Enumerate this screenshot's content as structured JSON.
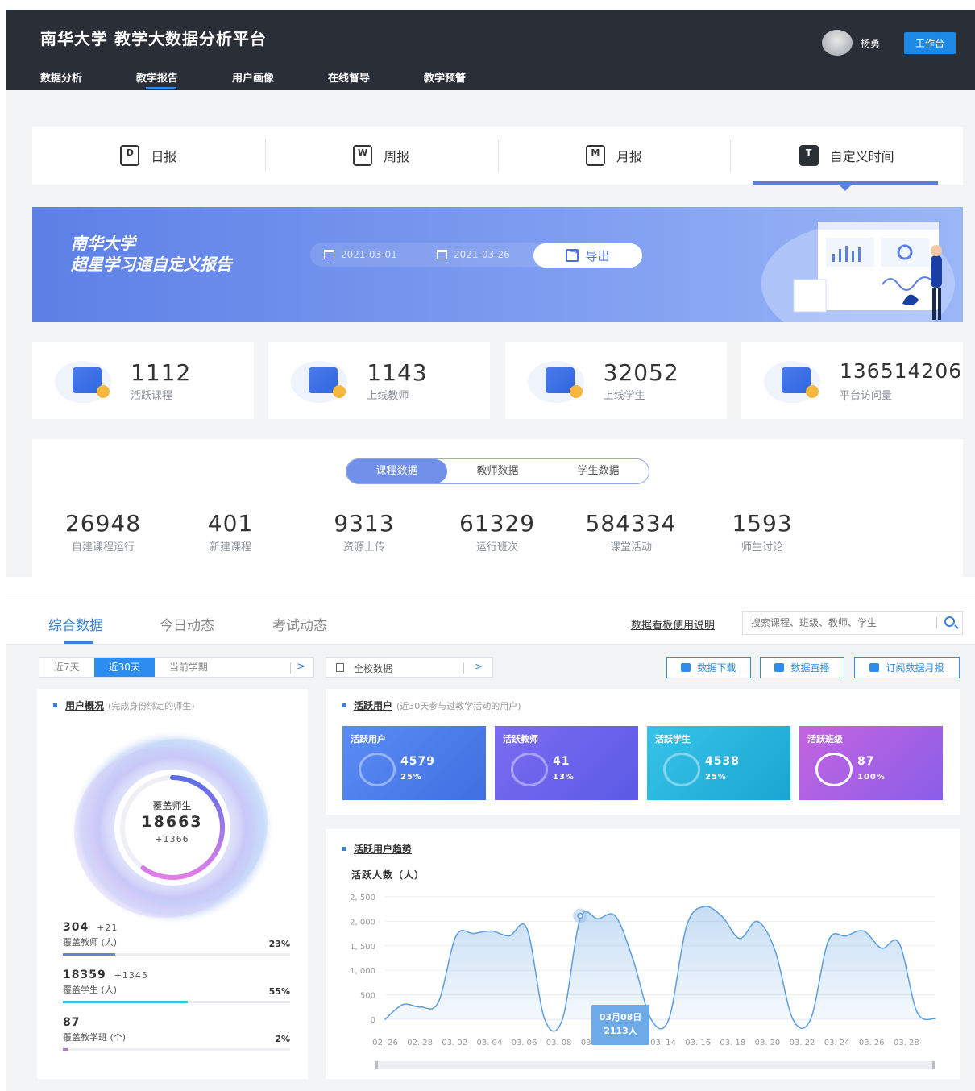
{
  "header": {
    "title": "南华大学 教学大数据分析平台",
    "nav": [
      "数据分析",
      "教学报告",
      "用户画像",
      "在线督导",
      "教学预警"
    ],
    "active_nav": 1,
    "user_name": "杨勇",
    "workbench_label": "工作台"
  },
  "report_tabs": [
    {
      "icon_letter": "D",
      "label": "日报"
    },
    {
      "icon_letter": "W",
      "label": "周报"
    },
    {
      "icon_letter": "M",
      "label": "月报"
    },
    {
      "icon_letter": "T",
      "label": "自定义时间"
    }
  ],
  "banner": {
    "title_line1": "南华大学",
    "title_line2": "超星学习通自定义报告",
    "start_date": "2021-03-01",
    "end_date": "2021-03-26",
    "export_label": "导出"
  },
  "kpis": [
    {
      "value": "1112",
      "label": "活跃课程",
      "icon": "course-icon"
    },
    {
      "value": "1143",
      "label": "上线教师",
      "icon": "teacher-icon"
    },
    {
      "value": "32052",
      "label": "上线学生",
      "icon": "student-icon"
    },
    {
      "value": "136514206",
      "label": "平台访问量",
      "icon": "visits-icon"
    }
  ],
  "course_panel": {
    "segments": [
      "课程数据",
      "教师数据",
      "学生数据"
    ],
    "active_segment": 0,
    "stats": [
      {
        "value": "26948",
        "label": "自建课程运行"
      },
      {
        "value": "401",
        "label": "新建课程"
      },
      {
        "value": "9313",
        "label": "资源上传"
      },
      {
        "value": "61329",
        "label": "运行班次"
      },
      {
        "value": "584334",
        "label": "课堂活动"
      },
      {
        "value": "1593",
        "label": "师生讨论"
      }
    ]
  },
  "dashboard": {
    "tabs": [
      "综合数据",
      "今日动态",
      "考试动态"
    ],
    "help_link": "数据看板使用说明",
    "search_placeholder": "搜索课程、班级、教师、学生",
    "time_filters": [
      "近7天",
      "近30天",
      "当前学期"
    ],
    "active_time_filter": 1,
    "scope_filter": "全校数据",
    "actions": [
      "数据下载",
      "数据直播",
      "订阅数据月报"
    ],
    "user_overview": {
      "title": "用户概况",
      "subtitle": "(完成身份绑定的师生)",
      "center_label": "覆盖师生",
      "center_value": "18663",
      "center_delta": "+1366",
      "center_ring_fraction": 0.6,
      "rows": [
        {
          "value": "304",
          "delta": "+21",
          "label": "覆盖教师 (人)",
          "pct": "23%",
          "fraction": 0.23,
          "color": "#6b7fe8"
        },
        {
          "value": "18359",
          "delta": "+1345",
          "label": "覆盖学生 (人)",
          "pct": "55%",
          "fraction": 0.55,
          "color": "#2fc4d8"
        },
        {
          "value": "87",
          "delta": "",
          "label": "覆盖教学班 (个)",
          "pct": "2%",
          "fraction": 0.02,
          "color": "#c86ce0"
        }
      ]
    },
    "active_users": {
      "title": "活跃用户",
      "subtitle": "(近30天参与过教学活动的用户)",
      "tiles": [
        {
          "label": "活跃用户",
          "value": "4579",
          "pct": "25%",
          "fraction": 0.25,
          "from": "#5b8cf5",
          "to": "#3f6fe0"
        },
        {
          "label": "活跃教师",
          "value": "41",
          "pct": "13%",
          "fraction": 0.13,
          "from": "#7b6cf0",
          "to": "#5b5ae6"
        },
        {
          "label": "活跃学生",
          "value": "4538",
          "pct": "25%",
          "fraction": 0.25,
          "from": "#38c3e8",
          "to": "#1aa5d2"
        },
        {
          "label": "活跃班级",
          "value": "87",
          "pct": "100%",
          "fraction": 1.0,
          "from": "#c464e0",
          "to": "#8a5ee8"
        }
      ]
    },
    "trend": {
      "title": "活跃用户趋势",
      "ylabel": "活跃人数（人）",
      "tooltip_date": "03月08日",
      "tooltip_value": "2113人"
    }
  },
  "chart_data": {
    "type": "area",
    "title": "活跃用户趋势",
    "ylabel": "活跃人数（人）",
    "ylim": [
      0,
      2500
    ],
    "yticks": [
      "2, 500",
      "2, 000",
      "1, 500",
      "1, 000",
      "500",
      "0"
    ],
    "ytick_values": [
      2500,
      2000,
      1500,
      1000,
      500,
      0
    ],
    "xtick_labels": [
      "02. 26",
      "02. 28",
      "03. 02",
      "03. 04",
      "03. 06",
      "03. 08",
      "03. 10",
      "03. 12",
      "03. 14",
      "03. 16",
      "03. 18",
      "03. 20",
      "03. 22",
      "03. 24",
      "03. 26",
      "03. 28"
    ],
    "x": [
      "02-25",
      "02-26",
      "02-27",
      "02-28",
      "03-01",
      "03-02",
      "03-03",
      "03-04",
      "03-05",
      "03-06",
      "03-07",
      "03-08",
      "03-09",
      "03-10",
      "03-11",
      "03-12",
      "03-13",
      "03-14",
      "03-15",
      "03-16",
      "03-17",
      "03-18",
      "03-19",
      "03-20",
      "03-21",
      "03-22",
      "03-23",
      "03-24",
      "03-25",
      "03-26",
      "03-27",
      "03-28"
    ],
    "series": [
      {
        "name": "活跃人数",
        "values": [
          0,
          300,
          250,
          350,
          1700,
          1750,
          1800,
          1700,
          1850,
          0,
          0,
          2050,
          2050,
          2100,
          1200,
          0,
          0,
          1900,
          2300,
          2100,
          1650,
          2000,
          1400,
          0,
          0,
          1600,
          1700,
          1800,
          1450,
          1550,
          150,
          10
        ]
      }
    ],
    "highlight": {
      "x": "03-08",
      "value": 2113
    },
    "grid": true,
    "color": "#5c9ee0"
  }
}
